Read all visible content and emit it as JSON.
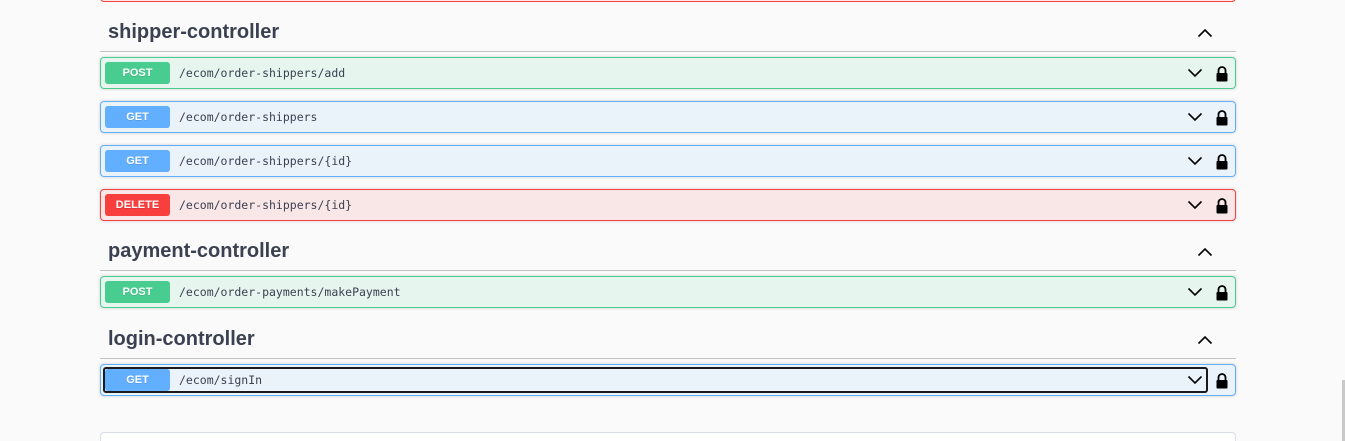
{
  "sections": [
    {
      "title": "shipper-controller",
      "operations": [
        {
          "method": "POST",
          "path": "/ecom/order-shippers/add"
        },
        {
          "method": "GET",
          "path": "/ecom/order-shippers"
        },
        {
          "method": "GET",
          "path": "/ecom/order-shippers/{id}"
        },
        {
          "method": "DELETE",
          "path": "/ecom/order-shippers/{id}"
        }
      ]
    },
    {
      "title": "payment-controller",
      "operations": [
        {
          "method": "POST",
          "path": "/ecom/order-payments/makePayment"
        }
      ]
    },
    {
      "title": "login-controller",
      "operations": [
        {
          "method": "GET",
          "path": "/ecom/signIn"
        }
      ]
    }
  ],
  "icons": {
    "collapse": "chevron-up-icon",
    "expand": "chevron-down-icon",
    "auth": "lock-icon"
  },
  "colors": {
    "post": "#49cc90",
    "get": "#61affe",
    "delete": "#f93e3e"
  }
}
